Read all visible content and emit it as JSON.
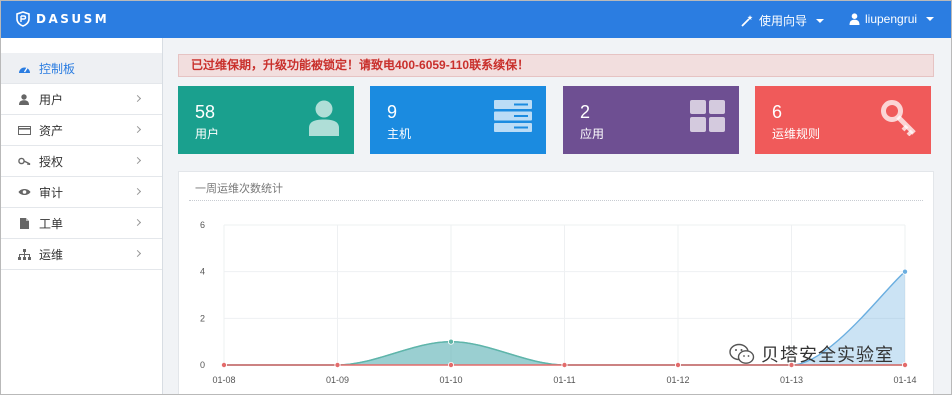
{
  "app": {
    "brand": "DASUSM"
  },
  "topbar": {
    "guide_label": "使用向导",
    "user_label": "liupengrui"
  },
  "sidebar": {
    "items": [
      {
        "label": "控制板",
        "icon": "dashboard-icon",
        "active": true
      },
      {
        "label": "用户",
        "icon": "user-icon"
      },
      {
        "label": "资产",
        "icon": "asset-card-icon"
      },
      {
        "label": "授权",
        "icon": "key-icon"
      },
      {
        "label": "审计",
        "icon": "eye-icon"
      },
      {
        "label": "工单",
        "icon": "document-icon"
      },
      {
        "label": "运维",
        "icon": "sitemap-icon"
      }
    ]
  },
  "alert": {
    "text": "已过维保期，升级功能被锁定！请致电400-6059-110联系续保！"
  },
  "stats": [
    {
      "value": "58",
      "label": "用户",
      "color": "#1aa08e",
      "icon": "user-icon"
    },
    {
      "value": "9",
      "label": "主机",
      "color": "#1b8be0",
      "icon": "server-icon"
    },
    {
      "value": "2",
      "label": "应用",
      "color": "#6e4f92",
      "icon": "grid-icon"
    },
    {
      "value": "6",
      "label": "运维规则",
      "color": "#f05a5a",
      "icon": "key-icon"
    }
  ],
  "panel": {
    "title": "一周运维次数统计"
  },
  "chart_data": {
    "type": "area",
    "categories": [
      "01-08",
      "01-09",
      "01-10",
      "01-11",
      "01-12",
      "01-13",
      "01-14"
    ],
    "ylim": [
      0,
      6
    ],
    "yticks": [
      0,
      2,
      4,
      6
    ],
    "series": [
      {
        "values": [
          0,
          0,
          1,
          0,
          0,
          0,
          4
        ],
        "color": "#6aaee0"
      },
      {
        "values": [
          0,
          0,
          1,
          0,
          0,
          0,
          0
        ],
        "color": "#5fb6a6"
      },
      {
        "values": [
          0,
          0,
          0,
          0,
          0,
          0,
          0
        ],
        "color": "#e36b6b"
      }
    ]
  },
  "watermark": {
    "text": "贝塔安全实验室"
  }
}
